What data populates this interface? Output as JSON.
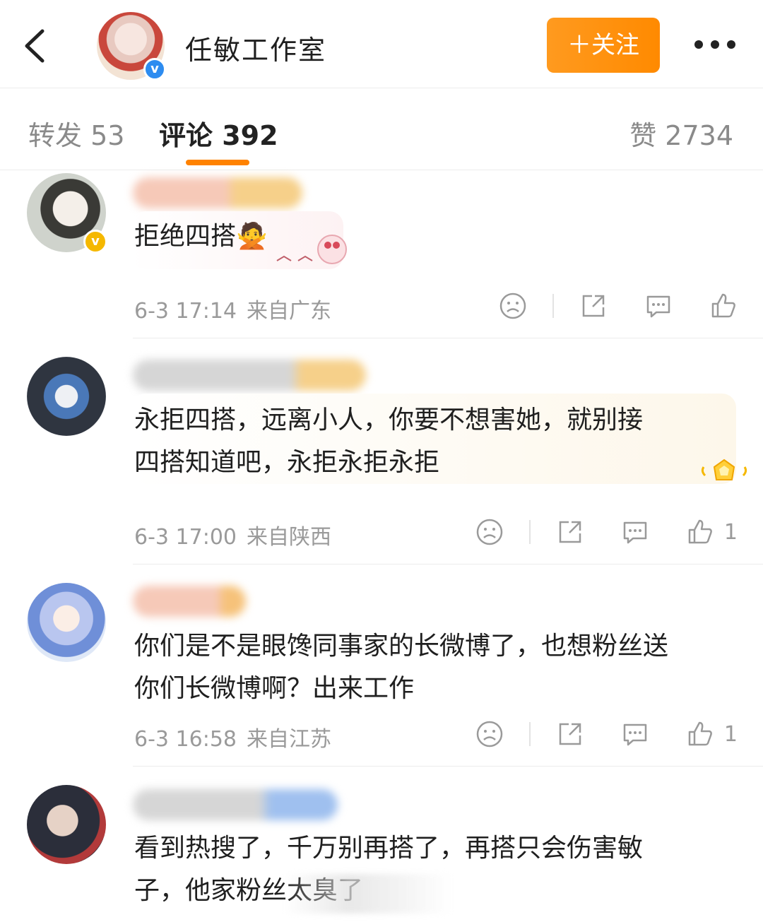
{
  "header": {
    "title": "任敏工作室",
    "follow_label": "＋关注",
    "verified_mark": "v"
  },
  "tabs": {
    "repost": "转发 53",
    "comments": "评论 392",
    "likes": "赞 2734"
  },
  "comments": [
    {
      "text": "拒绝四搭🙅",
      "date": "6-3 17:14",
      "location": "来自广东",
      "likes": ""
    },
    {
      "text_line1": "永拒四搭，远离小人，你要不想害她，就别接",
      "text_line2": "四搭知道吧，永拒永拒永拒",
      "date": "6-3 17:00",
      "location": "来自陕西",
      "likes": "1"
    },
    {
      "text_line1": "你们是不是眼馋同事家的长微博了，也想粉丝送",
      "text_line2": "你们长微博啊？出来工作",
      "date": "6-3 16:58",
      "location": "来自江苏",
      "likes": "1"
    },
    {
      "text_line1": "看到热搜了，千万别再搭了，再搭只会伤害敏",
      "text_line2": "子，他家粉丝太臭了",
      "date": "",
      "location": "",
      "likes": ""
    }
  ],
  "colors": {
    "accent": "#ff8200",
    "verified_blue": "#2d8cf0",
    "verified_gold": "#f5b800"
  }
}
